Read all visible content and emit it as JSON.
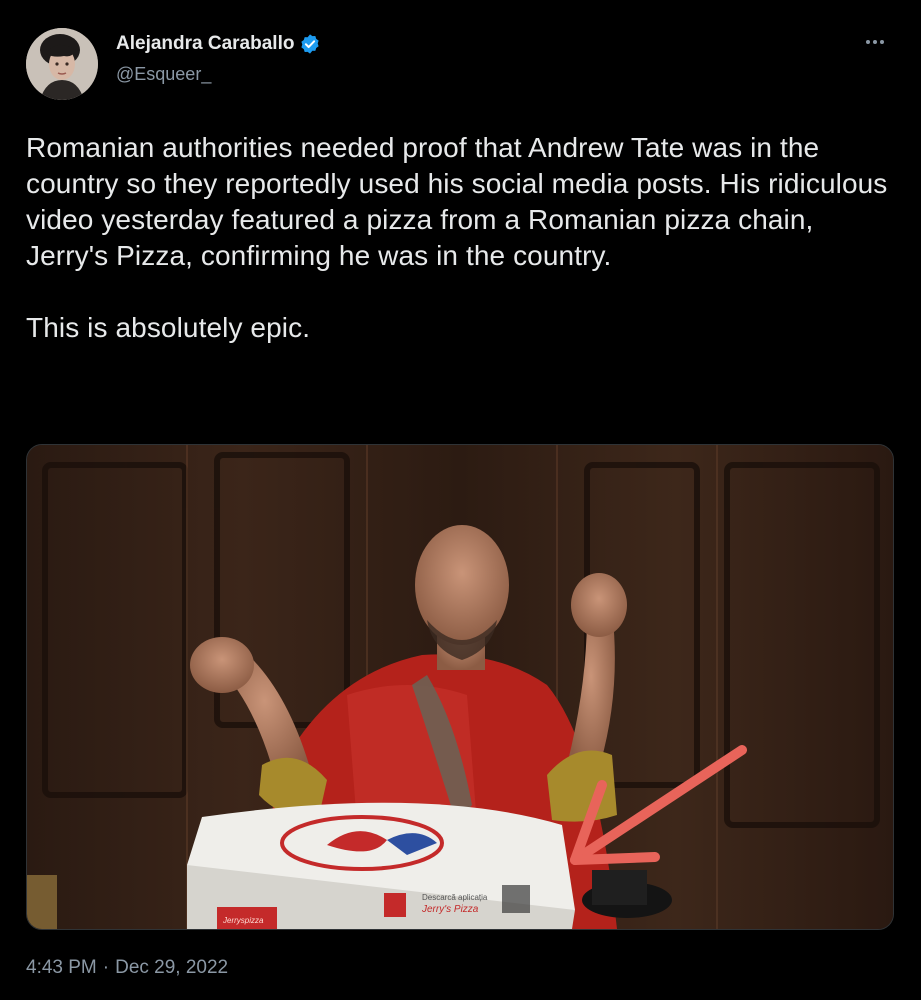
{
  "author": {
    "display_name": "Alejandra Caraballo",
    "handle": "@Esqueer_",
    "verified": true,
    "avatar_icon": "profile-photo"
  },
  "tweet": {
    "text": "Romanian authorities needed proof that Andrew Tate was in the country so they reportedly used his social media posts. His ridiculous video yesterday featured a pizza from a Romanian pizza chain, Jerry's Pizza, confirming he was in the country.\n\nThis is absolutely epic.",
    "time": "4:43 PM",
    "separator": "·",
    "date": "Dec 29, 2022"
  },
  "media": {
    "description_icon": "video-still-photo",
    "box_text": {
      "app_line": "Descarcă aplicația",
      "brand": "Jerry's Pizza",
      "site": "Jerryspizza"
    }
  },
  "colors": {
    "background": "#000000",
    "primary_text": "#e7e9ea",
    "secondary_text": "#8b98a5",
    "verified_blue": "#1d9bf0",
    "arrow": "#e8645a"
  }
}
